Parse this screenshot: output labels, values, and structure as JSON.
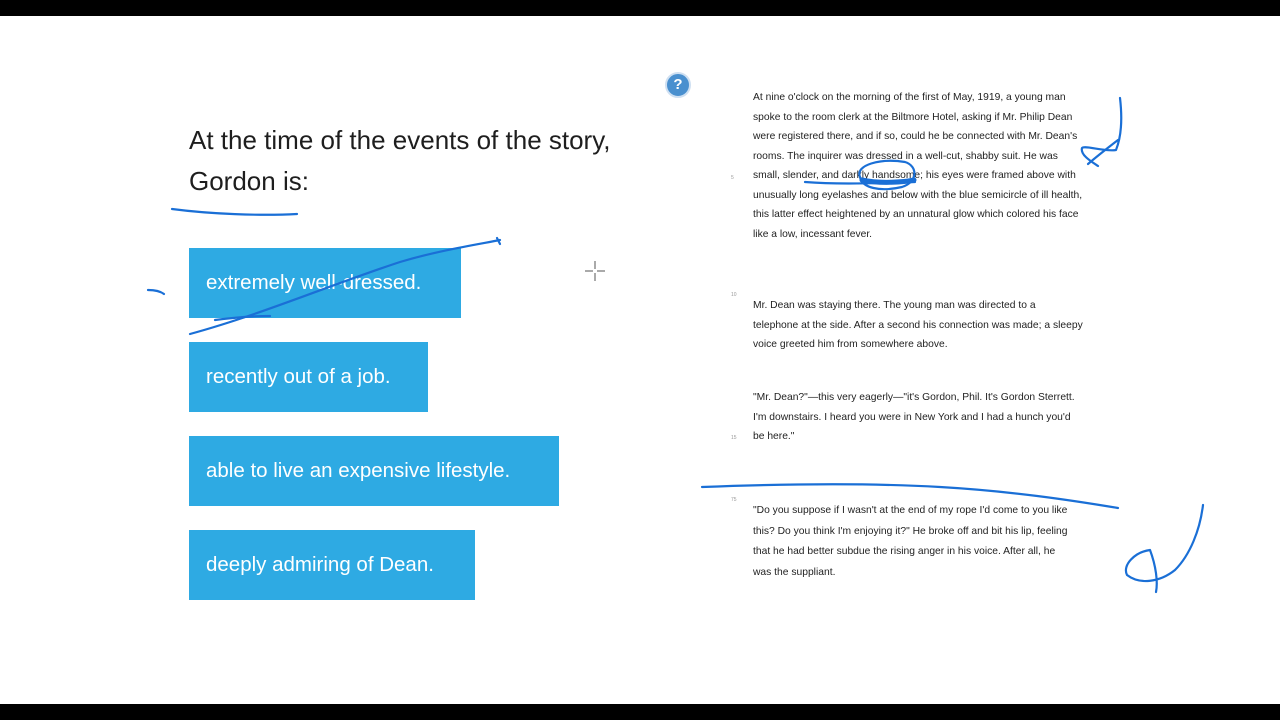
{
  "question": {
    "text": "At the time of the events of the story, Gordon is:"
  },
  "help_label": "?",
  "choices": [
    {
      "label": "extremely well-dressed."
    },
    {
      "label": "recently out of a job."
    },
    {
      "label": "able to live an expensive lifestyle."
    },
    {
      "label": "deeply admiring of Dean."
    }
  ],
  "passage": {
    "paragraphs": [
      "At nine o'clock on the morning of the first of May, 1919, a young man spoke to the room clerk at the Biltmore Hotel, asking if Mr. Philip Dean were registered there, and if so, could he be connected with Mr. Dean's rooms. The inquirer was dressed in a well-cut, shabby suit. He was small, slender, and darkly handsome; his eyes were framed above with unusually long eyelashes and below with the blue semicircle of ill health, this latter effect heightened by an unnatural glow which colored his face like a low, incessant fever.",
      "Mr. Dean was staying there. The young man was directed to a telephone at the side. After a second his connection was made; a sleepy voice greeted him from somewhere above.",
      "\"Mr. Dean?\"—this very eagerly—\"it's Gordon, Phil. It's Gordon Sterrett. I'm downstairs. I heard you were in New York and I had a hunch you'd be here.\"",
      "\"Do you suppose if I wasn't at the end of my rope I'd come to you like this? Do you think I'm enjoying it?\" He broke off and bit his lip, feeling that he had better subdue the rising anger in his voice. After all, he was the suppliant."
    ],
    "line_numbers": [
      "5",
      "10",
      "15",
      "75"
    ]
  },
  "colors": {
    "choice_bg": "#2eaae3",
    "annotation_ink": "#1a6fd6",
    "help_button": "#4a90cf"
  }
}
